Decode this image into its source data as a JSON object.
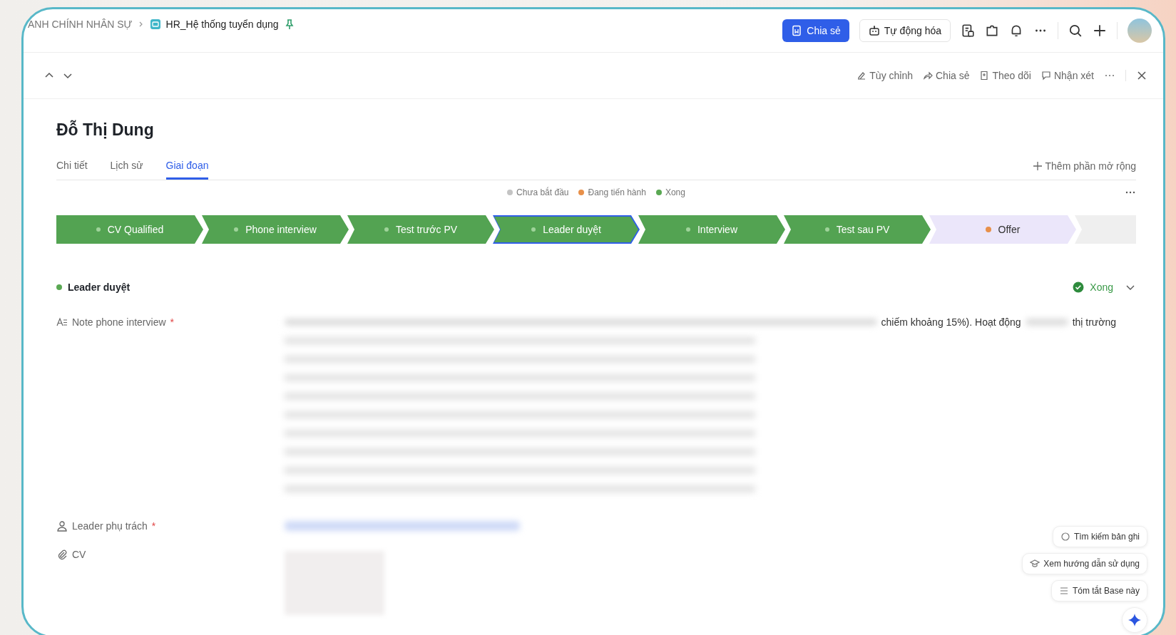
{
  "breadcrumb": {
    "parent": "ANH CHÍNH NHÂN SỰ",
    "base": "HR_Hệ thống tuyển dụng"
  },
  "top_actions": [
    {
      "label": "Chia sẻ",
      "kind": "primary"
    },
    {
      "label": "Tự động hóa",
      "kind": "outline"
    }
  ],
  "record_actions": [
    "Tùy chỉnh",
    "Chia sẻ",
    "Theo dõi",
    "Nhận xét"
  ],
  "record": {
    "title": "Đỗ Thị Dung"
  },
  "tabs": [
    {
      "label": "Chi tiết",
      "selected": false
    },
    {
      "label": "Lịch sử",
      "selected": false
    },
    {
      "label": "Giai đoạn",
      "selected": true
    }
  ],
  "add_extension": "Thêm phần mở rộng",
  "legend": [
    {
      "label": "Chưa bắt đầu",
      "color": "#c4c4c4"
    },
    {
      "label": "Đang tiến hành",
      "color": "#e8904a"
    },
    {
      "label": "Xong",
      "color": "#5aa853"
    }
  ],
  "stages": [
    {
      "label": "CV Qualified",
      "kind": "done",
      "selected": false
    },
    {
      "label": "Phone interview",
      "kind": "done",
      "selected": false
    },
    {
      "label": "Test trước PV",
      "kind": "done",
      "selected": false
    },
    {
      "label": "Leader duyệt",
      "kind": "done",
      "selected": true
    },
    {
      "label": "Interview",
      "kind": "done",
      "selected": false
    },
    {
      "label": "Test sau PV",
      "kind": "done",
      "selected": false
    },
    {
      "label": "Offer",
      "kind": "in_progress",
      "selected": false
    },
    {
      "kind": "not_started",
      "selected": false
    }
  ],
  "section": {
    "title": "Leader duyệt",
    "status": "Xong"
  },
  "fields": [
    {
      "kind": "text",
      "label": "Note phone interview",
      "required_mark": "*",
      "visible_fragments": [
        "chiếm khoảng 15%). Hoạt động",
        "thị trường"
      ]
    },
    {
      "kind": "user",
      "label": "Leader phụ trách",
      "required_mark": "*"
    },
    {
      "kind": "attachment",
      "label": "CV"
    }
  ],
  "assistant_suggestions": [
    "Tìm kiếm bản ghi",
    "Xem hướng dẫn sử dụng",
    "Tóm tắt Base này"
  ]
}
